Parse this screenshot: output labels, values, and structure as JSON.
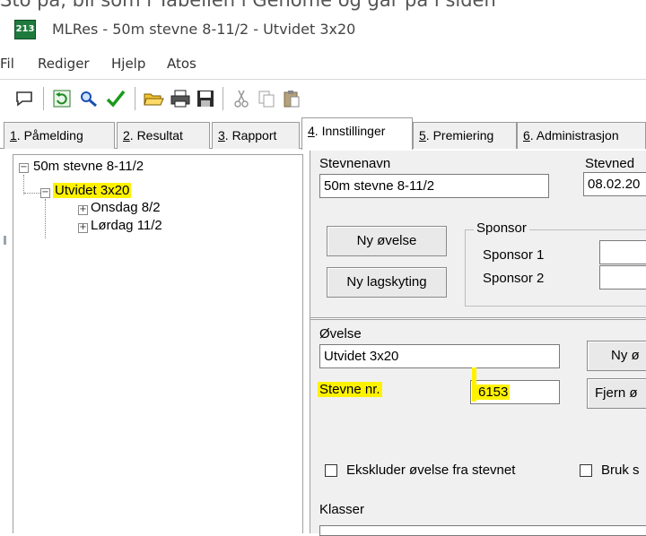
{
  "window": {
    "title": "MLRes - 50m stevne 8-11/2 - Utvidet 3x20",
    "icon_text": "213",
    "top_cropped_text": "Sto på, bli som i Tabellen i Genome og går på i siden"
  },
  "menu": [
    "Fil",
    "Rediger",
    "Hjelp",
    "Atos"
  ],
  "toolbar_icons": [
    "speech-bubble-icon",
    "refresh-icon",
    "search-icon",
    "checkmark-icon",
    "open-folder-icon",
    "print-icon",
    "save-icon",
    "cut-icon",
    "copy-icon",
    "paste-icon"
  ],
  "tabs": [
    {
      "num": "1",
      "label": ". Påmelding"
    },
    {
      "num": "2",
      "label": ". Resultat"
    },
    {
      "num": "3",
      "label": ". Rapport"
    },
    {
      "num": "4",
      "label": ". Innstillinger"
    },
    {
      "num": "5",
      "label": ". Premiering"
    },
    {
      "num": "6",
      "label": ". Administrasjon"
    }
  ],
  "tree": {
    "root": "50m stevne 8-11/2",
    "child": "Utvidet 3x20",
    "grandchildren": [
      "Onsdag 8/2",
      "Lørdag 11/2"
    ]
  },
  "settings": {
    "stevnenavn_label": "Stevnenavn",
    "stevnenavn_value": "50m stevne 8-11/2",
    "stevnedato_label": "Stevned",
    "stevnedato_value": "08.02.20",
    "ny_ovelse_button": "Ny øvelse",
    "ny_lagskyting_button": "Ny lagskyting",
    "sponsor_group": "Sponsor",
    "sponsor1_label": "Sponsor 1",
    "sponsor2_label": "Sponsor 2",
    "ovelse_label": "Øvelse",
    "ovelse_value": "Utvidet 3x20",
    "stevne_nr_label": "Stevne nr.",
    "stevne_nr_value": "6153",
    "ny_button_partial": "Ny ø",
    "fjern_button_partial": "Fjern ø",
    "ekskluder_label": "Ekskluder øvelse fra stevnet",
    "bruk_label": "Bruk s",
    "klasser_label": "Klasser"
  },
  "colors": {
    "highlight": "#fff200",
    "app_icon_bg": "#1f7a3d"
  }
}
